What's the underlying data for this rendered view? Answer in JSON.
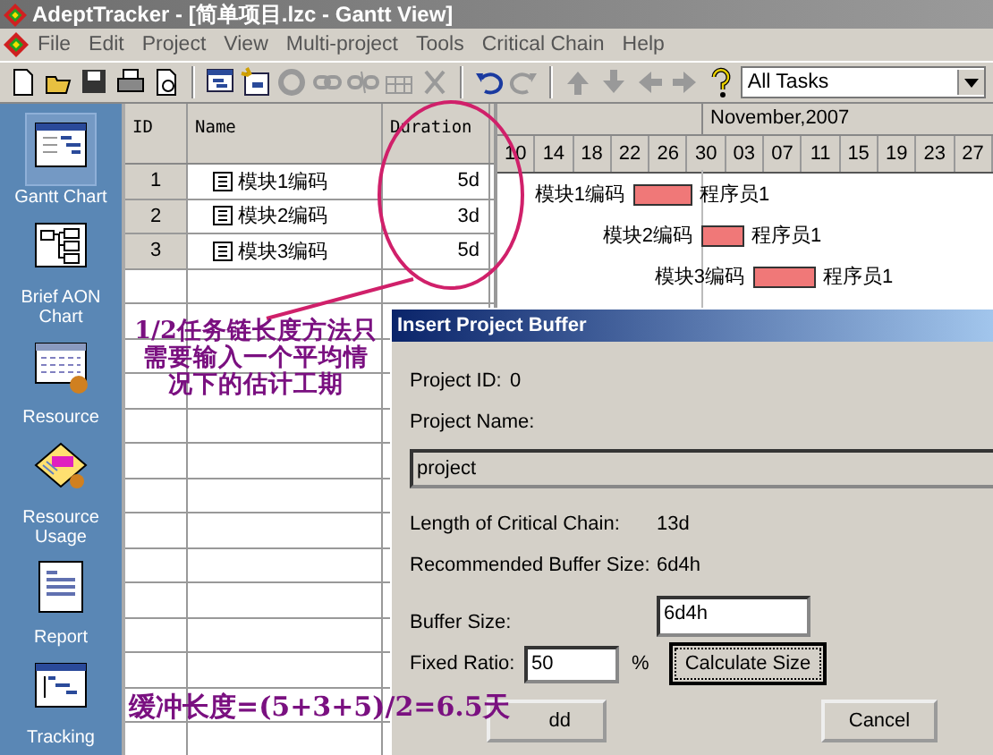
{
  "window": {
    "title": "AdeptTracker - [简单项目.lzc - Gantt View]"
  },
  "menu": [
    "File",
    "Edit",
    "Project",
    "View",
    "Multi-project",
    "Tools",
    "Critical Chain",
    "Help"
  ],
  "toolbar": {
    "filter": "All Tasks"
  },
  "sidebar": {
    "items": [
      {
        "label": "Gantt Chart",
        "selected": true
      },
      {
        "label": "Brief AON Chart",
        "selected": false
      },
      {
        "label": "Resource",
        "selected": false
      },
      {
        "label": "Resource Usage",
        "selected": false
      },
      {
        "label": "Report",
        "selected": false
      },
      {
        "label": "Tracking",
        "selected": false
      }
    ]
  },
  "table": {
    "columns": [
      "ID",
      "Name",
      "Duration"
    ],
    "rows": [
      {
        "id": "1",
        "name": "模块1编码",
        "duration": "5d"
      },
      {
        "id": "2",
        "name": "模块2编码",
        "duration": "3d"
      },
      {
        "id": "3",
        "name": "模块3编码",
        "duration": "5d"
      }
    ]
  },
  "gantt": {
    "month": "November,2007",
    "days": [
      "10",
      "14",
      "18",
      "22",
      "26",
      "30",
      "03",
      "07",
      "11",
      "15",
      "19",
      "23",
      "27"
    ],
    "bars": [
      {
        "task": "模块1编码",
        "resource": "程序员1"
      },
      {
        "task": "模块2编码",
        "resource": "程序员1"
      },
      {
        "task": "模块3编码",
        "resource": "程序员1"
      }
    ]
  },
  "dialog": {
    "title": "Insert Project Buffer",
    "project_id_label": "Project ID:",
    "project_id": "0",
    "project_name_label": "Project Name:",
    "project_name": "project",
    "chain_length_label": "Length of Critical Chain:",
    "chain_length": "13d",
    "recommended_label": "Recommended Buffer Size:",
    "recommended": "6d4h",
    "buffer_size_label": "Buffer Size:",
    "buffer_size": "6d4h",
    "ratio_label": "Fixed Ratio:",
    "ratio": "50",
    "ratio_unit": "%",
    "calculate_button": "Calculate Size",
    "add_button": "dd",
    "cancel_button": "Cancel"
  },
  "annotations": {
    "note": "1/2任务链长度方法只需要输入一个平均情况下的估计工期",
    "formula": "缓冲长度=(5+3+5)/2=6.5天"
  }
}
